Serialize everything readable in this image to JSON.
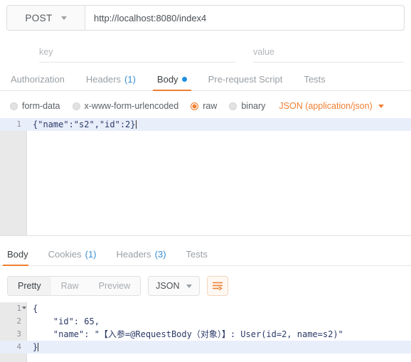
{
  "request": {
    "method": "POST",
    "url": "http://localhost:8080/index4",
    "params": {
      "key_placeholder": "key",
      "value_placeholder": "value"
    },
    "tabs": [
      {
        "label": "Authorization",
        "count": "",
        "active": false
      },
      {
        "label": "Headers",
        "count": "(1)",
        "active": false
      },
      {
        "label": "Body",
        "count": "",
        "active": true,
        "dot": true
      },
      {
        "label": "Pre-request Script",
        "count": "",
        "active": false
      },
      {
        "label": "Tests",
        "count": "",
        "active": false
      }
    ],
    "body_types": [
      {
        "label": "form-data",
        "selected": false
      },
      {
        "label": "x-www-form-urlencoded",
        "selected": false
      },
      {
        "label": "raw",
        "selected": true
      },
      {
        "label": "binary",
        "selected": false
      }
    ],
    "content_type": "JSON (application/json)",
    "body_lines": [
      {
        "num": "1",
        "text": "{\"name\":\"s2\",\"id\":2}",
        "highlight": true,
        "caret": true
      }
    ]
  },
  "response": {
    "tabs": [
      {
        "label": "Body",
        "count": "",
        "active": true
      },
      {
        "label": "Cookies",
        "count": "(1)",
        "active": false
      },
      {
        "label": "Headers",
        "count": "(3)",
        "active": false
      },
      {
        "label": "Tests",
        "count": "",
        "active": false
      }
    ],
    "view_modes": [
      {
        "label": "Pretty",
        "active": true
      },
      {
        "label": "Raw",
        "active": false
      },
      {
        "label": "Preview",
        "active": false
      }
    ],
    "format": "JSON",
    "wrap_icon": "word-wrap-icon",
    "body_lines": [
      {
        "num": "1",
        "text": "{",
        "fold": true,
        "highlight": false
      },
      {
        "num": "2",
        "text": "    \"id\": 65,",
        "highlight": false
      },
      {
        "num": "3",
        "text": "    \"name\": \"【入参=@RequestBody（对象）】: User(id=2, name=s2)\"",
        "highlight": false
      },
      {
        "num": "4",
        "text": "}",
        "highlight": true,
        "caret": true
      }
    ]
  },
  "colors": {
    "accent": "#ef7f32",
    "link": "#3a8fd6",
    "dot": "#1e8fe0",
    "code": "#2b3a67"
  }
}
